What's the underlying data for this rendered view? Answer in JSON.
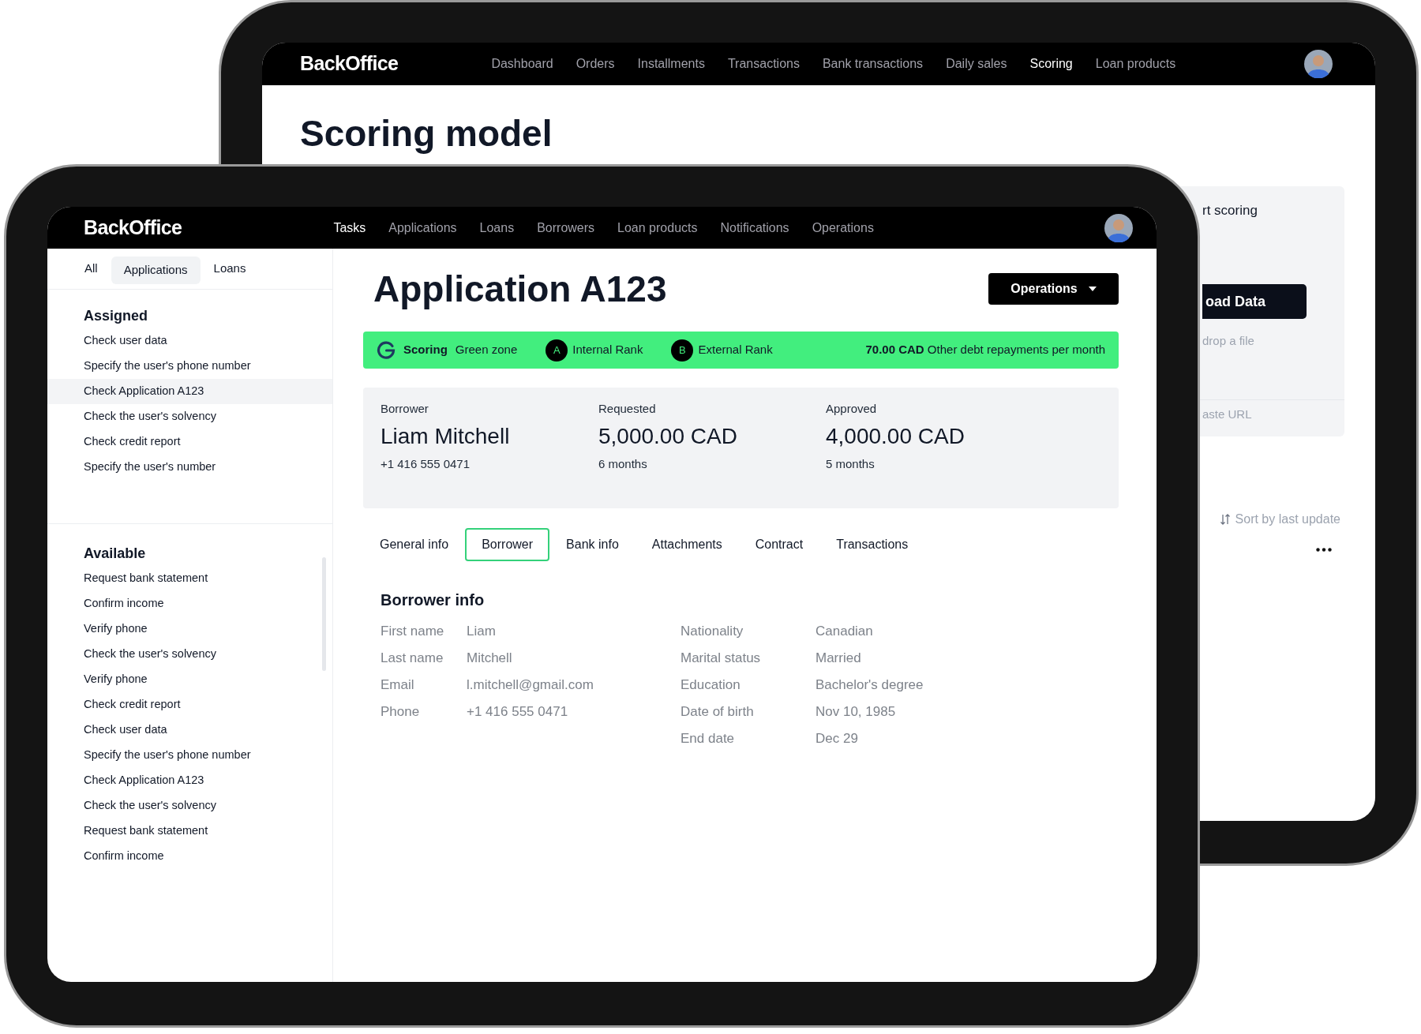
{
  "back_tablet": {
    "header": {
      "logo": "BackOffice",
      "nav": [
        {
          "label": "Dashboard",
          "selected": false
        },
        {
          "label": "Orders",
          "selected": false
        },
        {
          "label": "Installments",
          "selected": false
        },
        {
          "label": "Transactions",
          "selected": false
        },
        {
          "label": "Bank transactions",
          "selected": false
        },
        {
          "label": "Daily sales",
          "selected": false
        },
        {
          "label": "Scoring",
          "selected": true
        },
        {
          "label": "Loan products",
          "selected": false
        }
      ]
    },
    "title": "Scoring model",
    "upload_card": {
      "heading": "rt scoring",
      "button": "oad Data",
      "hint": "drop a file",
      "url_hint": "aste URL"
    },
    "sort_label": "Sort by last update"
  },
  "front_tablet": {
    "header": {
      "logo": "BackOffice",
      "nav": [
        {
          "label": "Tasks",
          "selected": true
        },
        {
          "label": "Applications",
          "selected": false
        },
        {
          "label": "Loans",
          "selected": false
        },
        {
          "label": "Borrowers",
          "selected": false
        },
        {
          "label": "Loan products",
          "selected": false
        },
        {
          "label": "Notifications",
          "selected": false
        },
        {
          "label": "Operations",
          "selected": false
        }
      ]
    },
    "sidebar": {
      "tabs": [
        {
          "label": "All",
          "selected": false
        },
        {
          "label": "Applications",
          "selected": true
        },
        {
          "label": "Loans",
          "selected": false
        }
      ],
      "sections": [
        {
          "title": "Assigned",
          "items": [
            {
              "label": "Check user data",
              "selected": false
            },
            {
              "label": "Specify the user's phone number",
              "selected": false
            },
            {
              "label": "Check Application A123",
              "selected": true
            },
            {
              "label": "Check the user's solvency",
              "selected": false
            },
            {
              "label": "Check credit report",
              "selected": false
            },
            {
              "label": "Specify the user's number",
              "selected": false
            }
          ]
        },
        {
          "title": "Available",
          "items": [
            {
              "label": "Request bank statement",
              "selected": false
            },
            {
              "label": "Confirm income",
              "selected": false
            },
            {
              "label": "Verify phone",
              "selected": false
            },
            {
              "label": "Check the user's solvency",
              "selected": false
            },
            {
              "label": "Verify phone",
              "selected": false
            },
            {
              "label": "Check credit report",
              "selected": false
            },
            {
              "label": "Check user data",
              "selected": false
            },
            {
              "label": "Specify the user's phone number",
              "selected": false
            },
            {
              "label": "Check Application A123",
              "selected": false
            },
            {
              "label": "Check the user's solvency",
              "selected": false
            },
            {
              "label": "Request bank statement",
              "selected": false
            },
            {
              "label": "Confirm income",
              "selected": false
            }
          ]
        }
      ]
    },
    "main": {
      "title": "Application A123",
      "operations_button": "Operations",
      "scoring_bar": {
        "label": "Scoring",
        "zone": "Green zone",
        "ranks": [
          {
            "grade": "A",
            "label": "Internal Rank"
          },
          {
            "grade": "B",
            "label": "External Rank"
          }
        ],
        "debt": "**70.00 CAD** Other debt repayments per month"
      },
      "summary": [
        {
          "label": "Borrower",
          "value": "Liam Mitchell",
          "detail": "+1 416 555 0471"
        },
        {
          "label": "Requested",
          "value": "5,000.00 CAD",
          "detail": "6 months"
        },
        {
          "label": "Approved",
          "value": "4,000.00 CAD",
          "detail": "5 months"
        }
      ],
      "tabs": [
        {
          "label": "General info",
          "selected": false
        },
        {
          "label": "Borrower",
          "selected": true
        },
        {
          "label": "Bank info",
          "selected": false
        },
        {
          "label": "Attachments",
          "selected": false
        },
        {
          "label": "Contract",
          "selected": false
        },
        {
          "label": "Transactions",
          "selected": false
        }
      ],
      "borrower_info": {
        "title": "Borrower info",
        "columns": [
          [
            {
              "label": "First name",
              "value": "Liam"
            },
            {
              "label": "Last name",
              "value": "Mitchell"
            },
            {
              "label": "Email",
              "value": "l.mitchell@gmail.com"
            },
            {
              "label": "Phone",
              "value": "+1 416 555 0471"
            }
          ],
          [
            {
              "label": "Nationality",
              "value": "Canadian"
            },
            {
              "label": "Marital status",
              "value": "Married"
            },
            {
              "label": "Education",
              "value": "Bachelor's degree"
            },
            {
              "label": "Date of birth",
              "value": "Nov 10, 1985"
            },
            {
              "label": "End date",
              "value": "Dec 29"
            }
          ]
        ]
      }
    }
  }
}
